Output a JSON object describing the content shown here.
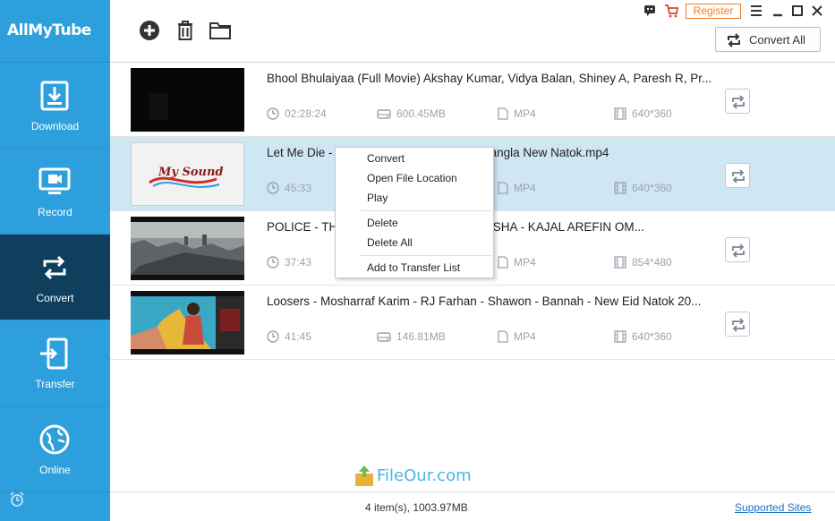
{
  "app": {
    "logo_text": "AllMyTube"
  },
  "sidebar": {
    "items": [
      {
        "label": "Download",
        "icon": "download-icon",
        "active": false
      },
      {
        "label": "Record",
        "icon": "record-icon",
        "active": false
      },
      {
        "label": "Convert",
        "icon": "convert-icon",
        "active": true
      },
      {
        "label": "Transfer",
        "icon": "transfer-icon",
        "active": false
      },
      {
        "label": "Online",
        "icon": "globe-icon",
        "active": false
      }
    ]
  },
  "toolbar": {
    "icons": [
      "add-icon",
      "trash-icon",
      "folder-icon"
    ],
    "register_label": "Register",
    "convert_all_label": "Convert All"
  },
  "files": [
    {
      "title": "Bhool Bhulaiyaa (Full Movie) Akshay Kumar, Vidya Balan, Shiney A, Paresh R, Pr...",
      "duration": "02:28:24",
      "size": "600.45MB",
      "format": "MP4",
      "resolution": "640*360",
      "selected": false
    },
    {
      "title": "Let Me Die - Tanjin Tisha - Shaila Sabi - Bangla New Natok.mp4",
      "duration": "45:33",
      "size": "",
      "format": "MP4",
      "resolution": "640*360",
      "selected": true,
      "thumb_text": "My Sound"
    },
    {
      "title": "POLICE - THANA - JALAL - D - TANJIN TISHA - KAJAL AREFIN OM...",
      "duration": "37:43",
      "size": "",
      "format": "MP4",
      "resolution": "854*480",
      "selected": false
    },
    {
      "title": "Loosers - Mosharraf Karim - RJ Farhan - Shawon - Bannah - New Eid Natok 20...",
      "duration": "41:45",
      "size": "146.81MB",
      "format": "MP4",
      "resolution": "640*360",
      "selected": false
    }
  ],
  "context_menu": {
    "items": [
      "Convert",
      "Open File Location",
      "Play",
      "Delete",
      "Delete All",
      "Add to Transfer List"
    ]
  },
  "watermark": {
    "text": "FileOur.com"
  },
  "status": {
    "summary": "4 item(s), 1003.97MB",
    "supported_sites": "Supported Sites"
  },
  "colors": {
    "sidebar": "#2e9fdd",
    "sidebar_active": "#0f3f5d",
    "selected_row": "#cfe6f3",
    "accent": "#f07b2c",
    "link": "#1d6fc4"
  }
}
